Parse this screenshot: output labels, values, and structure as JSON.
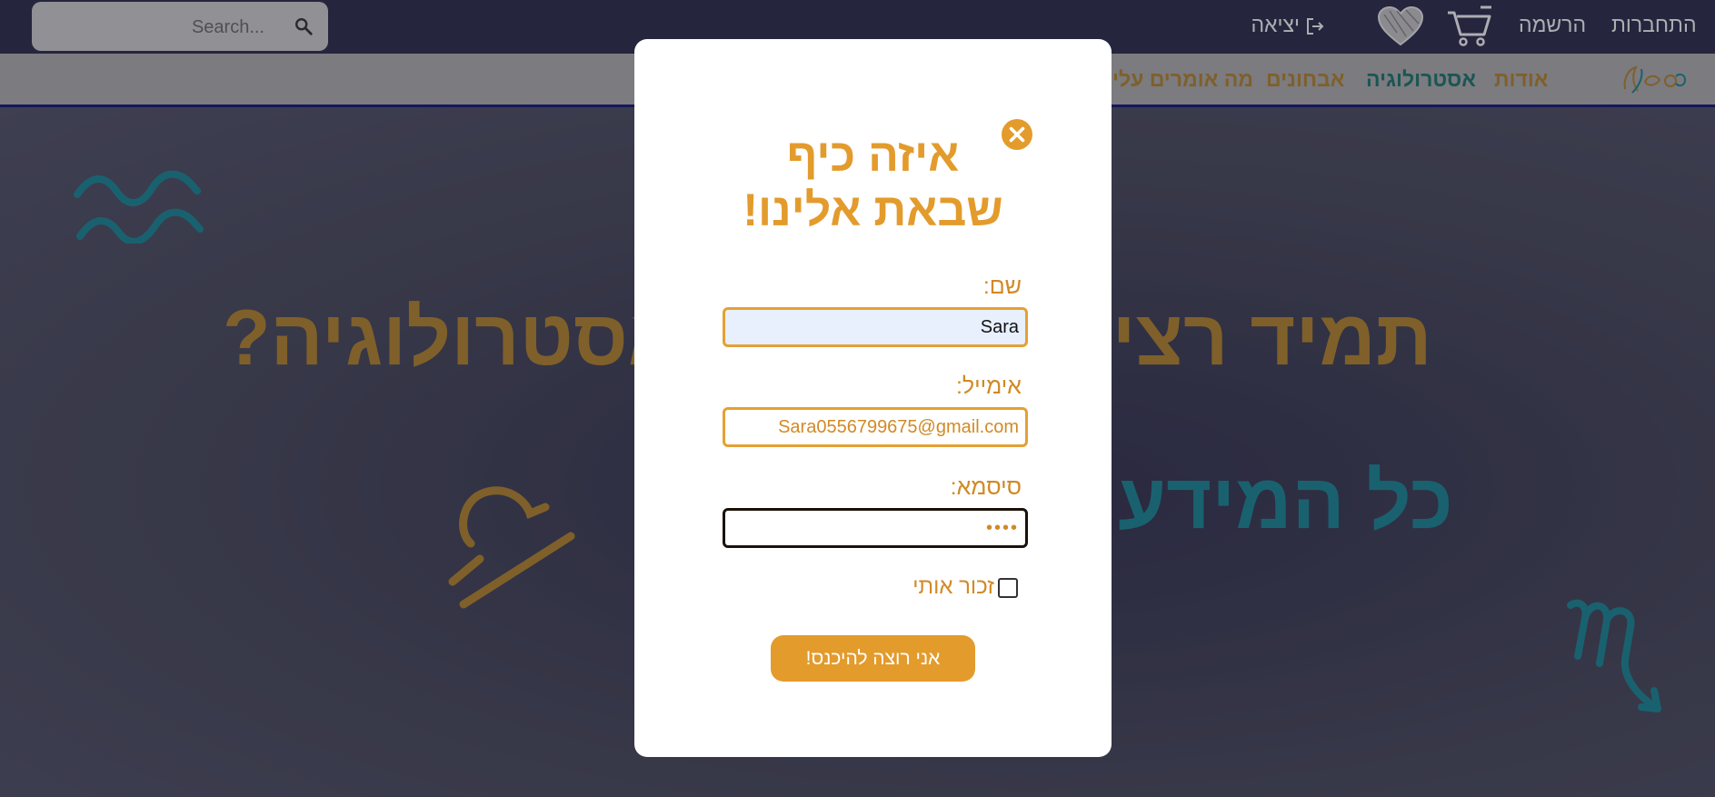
{
  "search": {
    "placeholder": "Search..."
  },
  "header": {
    "login_label": "התחברות",
    "register_label": "הרשמה",
    "logout_label": "יציאה"
  },
  "nav": {
    "items": [
      {
        "label": "אודות",
        "color": "#b8892f"
      },
      {
        "label": "אסטרולוגיה",
        "color": "#1e7a6e"
      },
      {
        "label": "אבחונים",
        "color": "#b8892f"
      },
      {
        "label": "מה אומרים עלי",
        "color": "#b8892f"
      }
    ]
  },
  "hero": {
    "title": "תמיד רציתי לדעת על אסטרולוגיה?",
    "subtitle": "כל המידע"
  },
  "login_modal": {
    "title_line1": "איזה כיף",
    "title_line2": "שבאת אלינו!",
    "name_label": "שם:",
    "name_value": "Sara",
    "email_label": "אימייל:",
    "email_value": "Sara0556799675@gmail.com",
    "password_label": "סיסמא:",
    "password_value": "••••",
    "remember_label": "זכור אותי",
    "remember_checked": false,
    "submit_label": "אני רוצה להיכנס!"
  },
  "colors": {
    "accent": "#e39b2c",
    "topbar_bg": "#2e2f4d",
    "nav_bg": "#b3b3b3",
    "teal": "#1e8a98",
    "gold": "#b8892f"
  },
  "icons": [
    "search-icon",
    "logout-icon",
    "heart-icon",
    "cart-icon",
    "close-icon",
    "aquarius-symbol-icon",
    "libra-symbol-icon",
    "scorpio-symbol-icon"
  ]
}
